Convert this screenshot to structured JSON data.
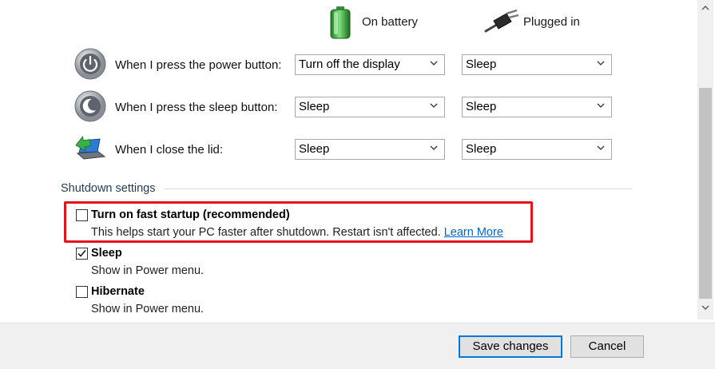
{
  "columns": {
    "battery_label": "On battery",
    "plugged_label": "Plugged in"
  },
  "rows": [
    {
      "label": "When I press the power button:",
      "battery": "Turn off the display",
      "plugged": "Sleep"
    },
    {
      "label": "When I press the sleep button:",
      "battery": "Sleep",
      "plugged": "Sleep"
    },
    {
      "label": "When I close the lid:",
      "battery": "Sleep",
      "plugged": "Sleep"
    }
  ],
  "shutdown": {
    "title": "Shutdown settings",
    "options": [
      {
        "title": "Turn on fast startup (recommended)",
        "desc": "This helps start your PC faster after shutdown. Restart isn't affected.",
        "link": "Learn More",
        "checked": false
      },
      {
        "title": "Sleep",
        "desc": "Show in Power menu.",
        "checked": true
      },
      {
        "title": "Hibernate",
        "desc": "Show in Power menu.",
        "checked": false
      }
    ]
  },
  "footer": {
    "save_label": "Save changes",
    "cancel_label": "Cancel"
  },
  "colors": {
    "highlight": "#e3151a",
    "link": "#0066cc",
    "primary_border": "#0078d7"
  },
  "icons": [
    "battery-icon",
    "plug-icon",
    "power-button-icon",
    "sleep-button-icon",
    "lid-icon",
    "chevron-down-icon",
    "checkmark-icon",
    "scroll-up-icon",
    "scroll-down-icon"
  ]
}
